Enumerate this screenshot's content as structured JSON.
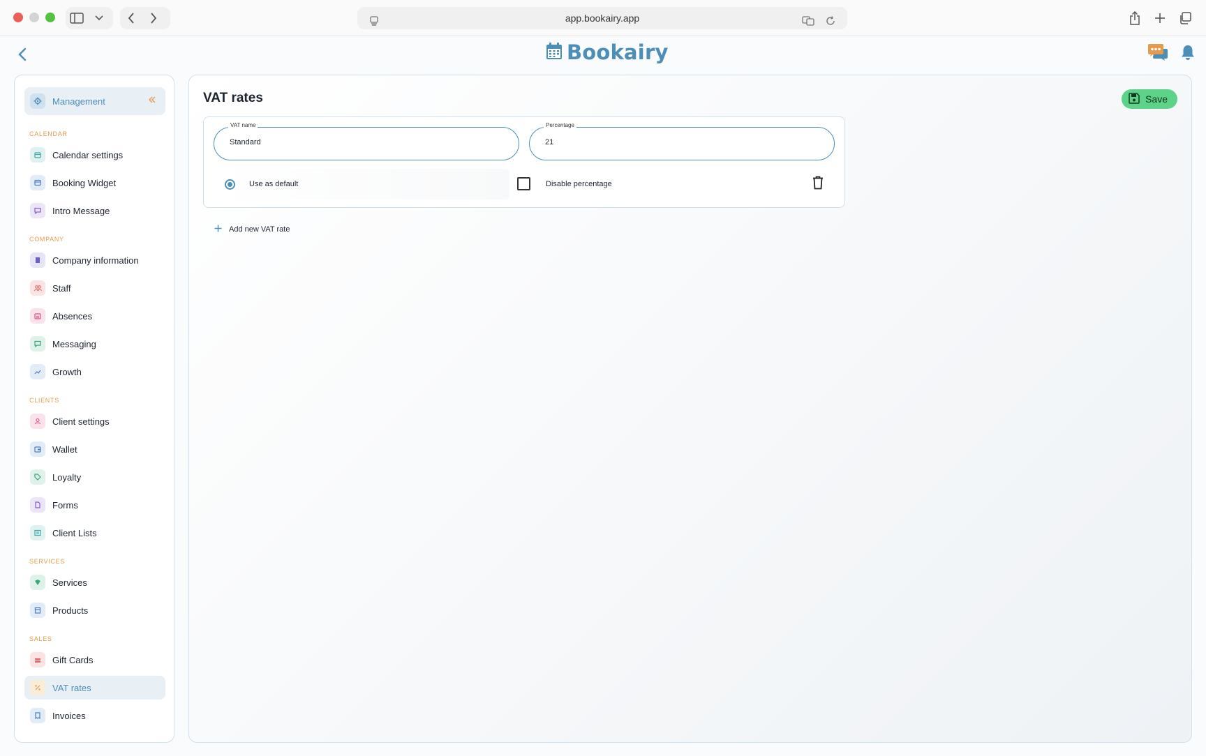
{
  "browser": {
    "url": "app.bookairy.app"
  },
  "app": {
    "logo_text": "Bookairy",
    "brand_color": "#4b8fb8",
    "accent_color": "#e59b4e"
  },
  "sidebar": {
    "header_label": "Management",
    "sections": [
      {
        "title": "Calendar",
        "items": [
          {
            "label": "Calendar settings",
            "icon": "calendar-icon"
          },
          {
            "label": "Booking Widget",
            "icon": "widget-icon"
          },
          {
            "label": "Intro Message",
            "icon": "message-icon"
          }
        ]
      },
      {
        "title": "Company",
        "items": [
          {
            "label": "Company information",
            "icon": "building-icon"
          },
          {
            "label": "Staff",
            "icon": "staff-icon"
          },
          {
            "label": "Absences",
            "icon": "absence-icon"
          },
          {
            "label": "Messaging",
            "icon": "chat-icon"
          },
          {
            "label": "Growth",
            "icon": "growth-icon"
          }
        ]
      },
      {
        "title": "Clients",
        "items": [
          {
            "label": "Client settings",
            "icon": "user-icon"
          },
          {
            "label": "Wallet",
            "icon": "wallet-icon"
          },
          {
            "label": "Loyalty",
            "icon": "tag-icon"
          },
          {
            "label": "Forms",
            "icon": "form-icon"
          },
          {
            "label": "Client Lists",
            "icon": "list-icon"
          }
        ]
      },
      {
        "title": "Services",
        "items": [
          {
            "label": "Services",
            "icon": "services-icon"
          },
          {
            "label": "Products",
            "icon": "box-icon"
          }
        ]
      },
      {
        "title": "Sales",
        "items": [
          {
            "label": "Gift Cards",
            "icon": "gift-icon"
          },
          {
            "label": "VAT rates",
            "icon": "percent-icon",
            "active": true
          },
          {
            "label": "Invoices",
            "icon": "invoice-icon"
          }
        ]
      }
    ]
  },
  "main": {
    "title": "VAT rates",
    "save_label": "Save",
    "vat_rates": [
      {
        "name_label": "VAT name",
        "name_value": "Standard",
        "percentage_label": "Percentage",
        "percentage_value": "21",
        "use_as_default_label": "Use as default",
        "use_as_default": true,
        "disable_percentage_label": "Disable percentage",
        "disable_percentage": false
      }
    ],
    "add_label": "Add new VAT rate"
  }
}
